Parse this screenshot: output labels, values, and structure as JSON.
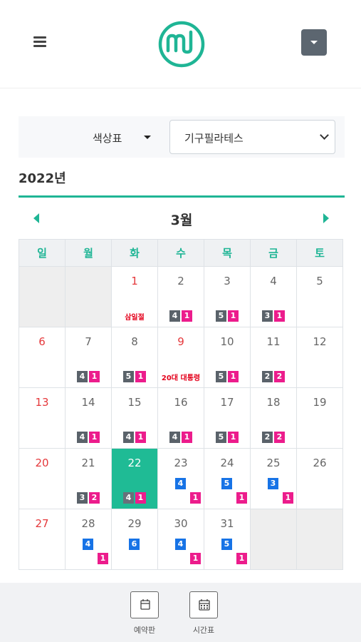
{
  "header": {
    "logo": "ml"
  },
  "filter": {
    "color_label": "색상표",
    "branch_value": "기구필라테스"
  },
  "year_label": "2022년",
  "month_label": "3월",
  "weekdays": [
    "일",
    "월",
    "화",
    "수",
    "목",
    "금",
    "토"
  ],
  "holidays": {
    "d1": "삼일절",
    "d9": "20대 대통령"
  },
  "colors": {
    "accent": "#1fb595",
    "gray_badge": "#5a626a",
    "pink_badge": "#ec1c8c",
    "blue_badge": "#1773e6",
    "holiday_red": "#e5383b"
  },
  "days": {
    "d1": {
      "num": "1"
    },
    "d2": {
      "num": "2",
      "gray": "4",
      "pink": "1"
    },
    "d3": {
      "num": "3",
      "gray": "5",
      "pink": "1"
    },
    "d4": {
      "num": "4",
      "gray": "3",
      "pink": "1"
    },
    "d5": {
      "num": "5"
    },
    "d6": {
      "num": "6"
    },
    "d7": {
      "num": "7",
      "gray": "4",
      "pink": "1"
    },
    "d8": {
      "num": "8",
      "gray": "5",
      "pink": "1"
    },
    "d9": {
      "num": "9"
    },
    "d10": {
      "num": "10",
      "gray": "5",
      "pink": "1"
    },
    "d11": {
      "num": "11",
      "gray": "2",
      "pink": "2"
    },
    "d12": {
      "num": "12"
    },
    "d13": {
      "num": "13"
    },
    "d14": {
      "num": "14",
      "gray": "4",
      "pink": "1"
    },
    "d15": {
      "num": "15",
      "gray": "4",
      "pink": "1"
    },
    "d16": {
      "num": "16",
      "gray": "4",
      "pink": "1"
    },
    "d17": {
      "num": "17",
      "gray": "5",
      "pink": "1"
    },
    "d18": {
      "num": "18",
      "gray": "2",
      "pink": "2"
    },
    "d19": {
      "num": "19"
    },
    "d20": {
      "num": "20"
    },
    "d21": {
      "num": "21",
      "gray": "3",
      "pink": "2"
    },
    "d22": {
      "num": "22",
      "gray": "4",
      "pink": "1"
    },
    "d23": {
      "num": "23",
      "blue": "4",
      "pink": "1"
    },
    "d24": {
      "num": "24",
      "blue": "5",
      "pink": "1"
    },
    "d25": {
      "num": "25",
      "blue": "3",
      "pink": "1"
    },
    "d26": {
      "num": "26"
    },
    "d27": {
      "num": "27"
    },
    "d28": {
      "num": "28",
      "blue": "4",
      "pink": "1"
    },
    "d29": {
      "num": "29",
      "blue": "6"
    },
    "d30": {
      "num": "30",
      "blue": "4",
      "pink": "1"
    },
    "d31": {
      "num": "31",
      "blue": "5",
      "pink": "1"
    }
  },
  "bottom_nav": {
    "reservation_label": "예약판",
    "schedule_label": "시간표"
  }
}
